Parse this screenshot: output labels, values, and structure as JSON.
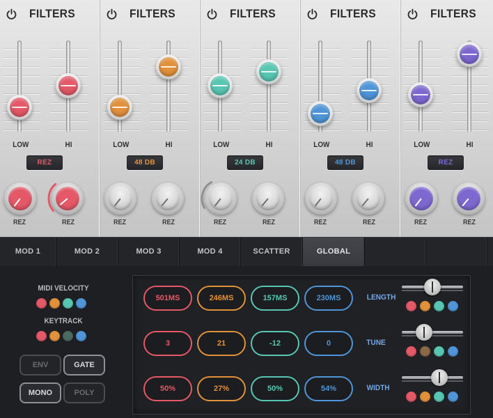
{
  "colors": {
    "red": "#e45867",
    "orange": "#e2913b",
    "teal": "#58c7b2",
    "blue": "#4f95d8",
    "purple": "#7d68d0",
    "olive": "#8a6a46",
    "darkteal": "#4b6a60"
  },
  "filters": [
    {
      "title": "FILTERS",
      "low_label": "LOW",
      "hi_label": "HI",
      "badge": "REZ",
      "knob1_label": "REZ",
      "knob2_label": "REZ",
      "color": "#e45867",
      "low_level": 0.3,
      "hi_level": 0.58
    },
    {
      "title": "FILTERS",
      "low_label": "LOW",
      "hi_label": "HI",
      "badge": "48 DB",
      "knob1_label": "REZ",
      "knob2_label": "REZ",
      "color": "#e2913b",
      "low_level": 0.3,
      "hi_level": 0.82
    },
    {
      "title": "FILTERS",
      "low_label": "LOW",
      "hi_label": "HI",
      "badge": "24 DB",
      "knob1_label": "REZ",
      "knob2_label": "REZ",
      "color": "#58c7b2",
      "low_level": 0.58,
      "hi_level": 0.76
    },
    {
      "title": "FILTERS",
      "low_label": "LOW",
      "hi_label": "HI",
      "badge": "48 DB",
      "knob1_label": "REZ",
      "knob2_label": "REZ",
      "color": "#4f95d8",
      "low_level": 0.22,
      "hi_level": 0.52
    },
    {
      "title": "FILTERS",
      "low_label": "LOW",
      "hi_label": "HI",
      "badge": "REZ",
      "knob1_label": "REZ",
      "knob2_label": "REZ",
      "color": "#7d68d0",
      "low_level": 0.46,
      "hi_level": 0.98
    }
  ],
  "tabs": [
    {
      "label": "MOD 1"
    },
    {
      "label": "MOD 2"
    },
    {
      "label": "MOD 3"
    },
    {
      "label": "MOD 4"
    },
    {
      "label": "SCATTER"
    },
    {
      "label": "GLOBAL",
      "active": true
    },
    {
      "label": ""
    },
    {
      "label": ""
    }
  ],
  "global": {
    "midi_velocity_label": "MIDI VELOCITY",
    "keytrack_label": "KEYTRACK",
    "midi_velocity_dots": [
      "#e45867",
      "#e2913b",
      "#58c7b2",
      "#4f95d8"
    ],
    "keytrack_dots": [
      "#e45867",
      "#e2913b",
      "#4b6a60",
      "#4f95d8"
    ],
    "env_label": "ENV",
    "gate_label": "GATE",
    "mono_label": "MONO",
    "poly_label": "POLY",
    "rows": [
      {
        "label": "LENGTH",
        "values": [
          "501MS",
          "246MS",
          "157MS",
          "230MS"
        ],
        "slider": 0.5,
        "dots": [
          "#e45867",
          "#e2913b",
          "#58c7b2",
          "#4f95d8"
        ]
      },
      {
        "label": "TUNE",
        "values": [
          "3",
          "21",
          "-12",
          "0"
        ],
        "slider": 0.32,
        "dots": [
          "#e45867",
          "#8a6a46",
          "#58c7b2",
          "#4f95d8"
        ]
      },
      {
        "label": "WIDTH",
        "values": [
          "50%",
          "27%",
          "50%",
          "54%"
        ],
        "slider": 0.66,
        "dots": [
          "#e45867",
          "#e2913b",
          "#58c7b2",
          "#4f95d8"
        ]
      }
    ]
  }
}
